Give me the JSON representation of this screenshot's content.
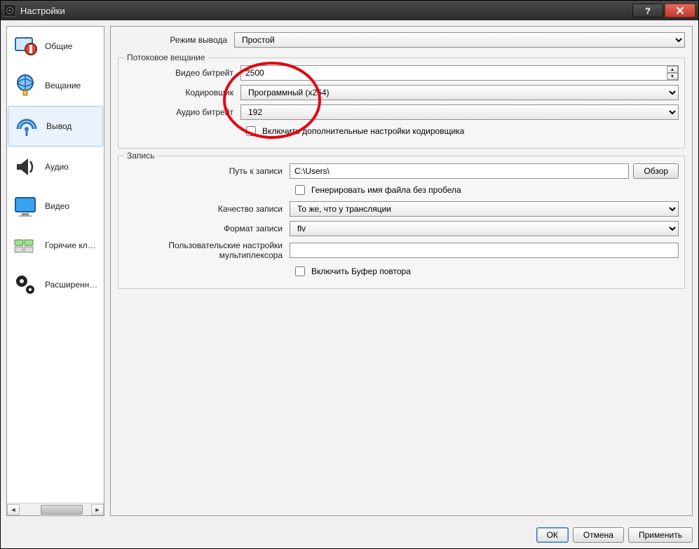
{
  "window": {
    "title": "Настройки"
  },
  "sidebar": {
    "items": [
      {
        "key": "general",
        "label": "Общие"
      },
      {
        "key": "stream",
        "label": "Вещание"
      },
      {
        "key": "output",
        "label": "Вывод"
      },
      {
        "key": "audio",
        "label": "Аудио"
      },
      {
        "key": "video",
        "label": "Видео"
      },
      {
        "key": "hotkeys",
        "label": "Горячие кл…"
      },
      {
        "key": "advanced",
        "label": "Расширенн…"
      }
    ],
    "selected": "output"
  },
  "header": {
    "mode_label": "Режим вывода",
    "mode_value": "Простой"
  },
  "streaming": {
    "group_title": "Потоковое вещание",
    "video_bitrate_label": "Видео битрейт",
    "video_bitrate_value": "2500",
    "encoder_label": "Кодировщик",
    "encoder_value": "Программный (x264)",
    "audio_bitrate_label": "Аудио битрейт",
    "audio_bitrate_value": "192",
    "adv_checkbox_label": "Включить дополнительные настройки кодировщика"
  },
  "recording": {
    "group_title": "Запись",
    "path_label": "Путь к записи",
    "path_value": "C:\\Users\\",
    "browse_label": "Обзор",
    "gen_filename_label": "Генерировать имя файла без пробела",
    "quality_label": "Качество записи",
    "quality_value": "То же, что у трансляции",
    "format_label": "Формат записи",
    "format_value": "flv",
    "muxer_label": "Пользовательские настройки мультиплексора",
    "replay_buffer_label": "Включить Буфер повтора"
  },
  "footer": {
    "ok": "ОК",
    "cancel": "Отмена",
    "apply": "Применить"
  }
}
